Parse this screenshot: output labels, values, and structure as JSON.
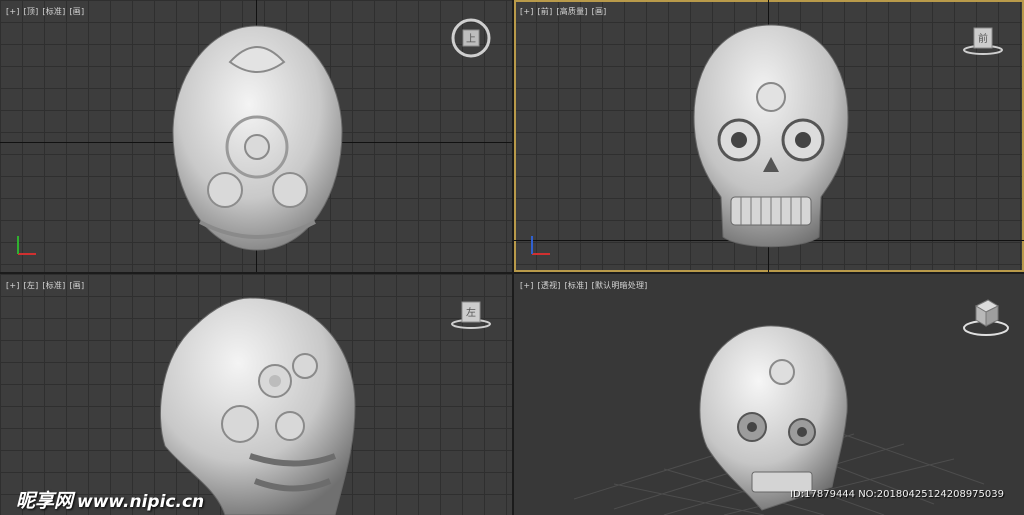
{
  "viewports": {
    "top": {
      "labels": [
        "[+]",
        "[顶]",
        "[标准]",
        "[画]"
      ],
      "cube_text": "上"
    },
    "front": {
      "labels": [
        "[+]",
        "[前]",
        "[高质量]",
        "[画]"
      ],
      "cube_text": "前"
    },
    "left": {
      "labels": [
        "[+]",
        "[左]",
        "[标准]",
        "[画]"
      ],
      "cube_text": "左"
    },
    "persp": {
      "labels": [
        "[+]",
        "[透视]",
        "[标准]",
        "[默认明暗处理]"
      ]
    }
  },
  "watermark": {
    "logo": "昵享网",
    "url": "www.nipic.cn",
    "id_text": "ID:17879444 NO:20180425124208975039"
  },
  "colors": {
    "active_border": "#b99a4a",
    "background": "#3d3d3d",
    "grid": "#2f2f2f"
  }
}
